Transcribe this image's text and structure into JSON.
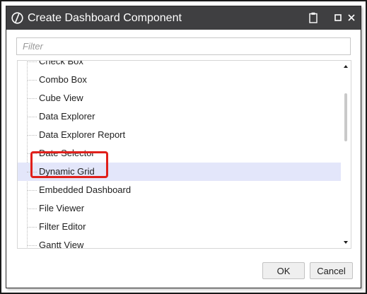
{
  "dialog": {
    "title": "Create Dashboard Component"
  },
  "filter": {
    "placeholder": "Filter",
    "value": ""
  },
  "list": {
    "items": [
      {
        "label": "Check Box"
      },
      {
        "label": "Combo Box"
      },
      {
        "label": "Cube View"
      },
      {
        "label": "Data Explorer"
      },
      {
        "label": "Data Explorer Report"
      },
      {
        "label": "Date Selector"
      },
      {
        "label": "Dynamic Grid",
        "selected": true
      },
      {
        "label": "Embedded Dashboard"
      },
      {
        "label": "File Viewer"
      },
      {
        "label": "Filter Editor"
      },
      {
        "label": "Gantt View"
      }
    ]
  },
  "buttons": {
    "ok": "OK",
    "cancel": "Cancel"
  },
  "colors": {
    "titlebar": "#3f3f41",
    "selection": "#e3e6fa",
    "highlight": "#e0201b"
  }
}
